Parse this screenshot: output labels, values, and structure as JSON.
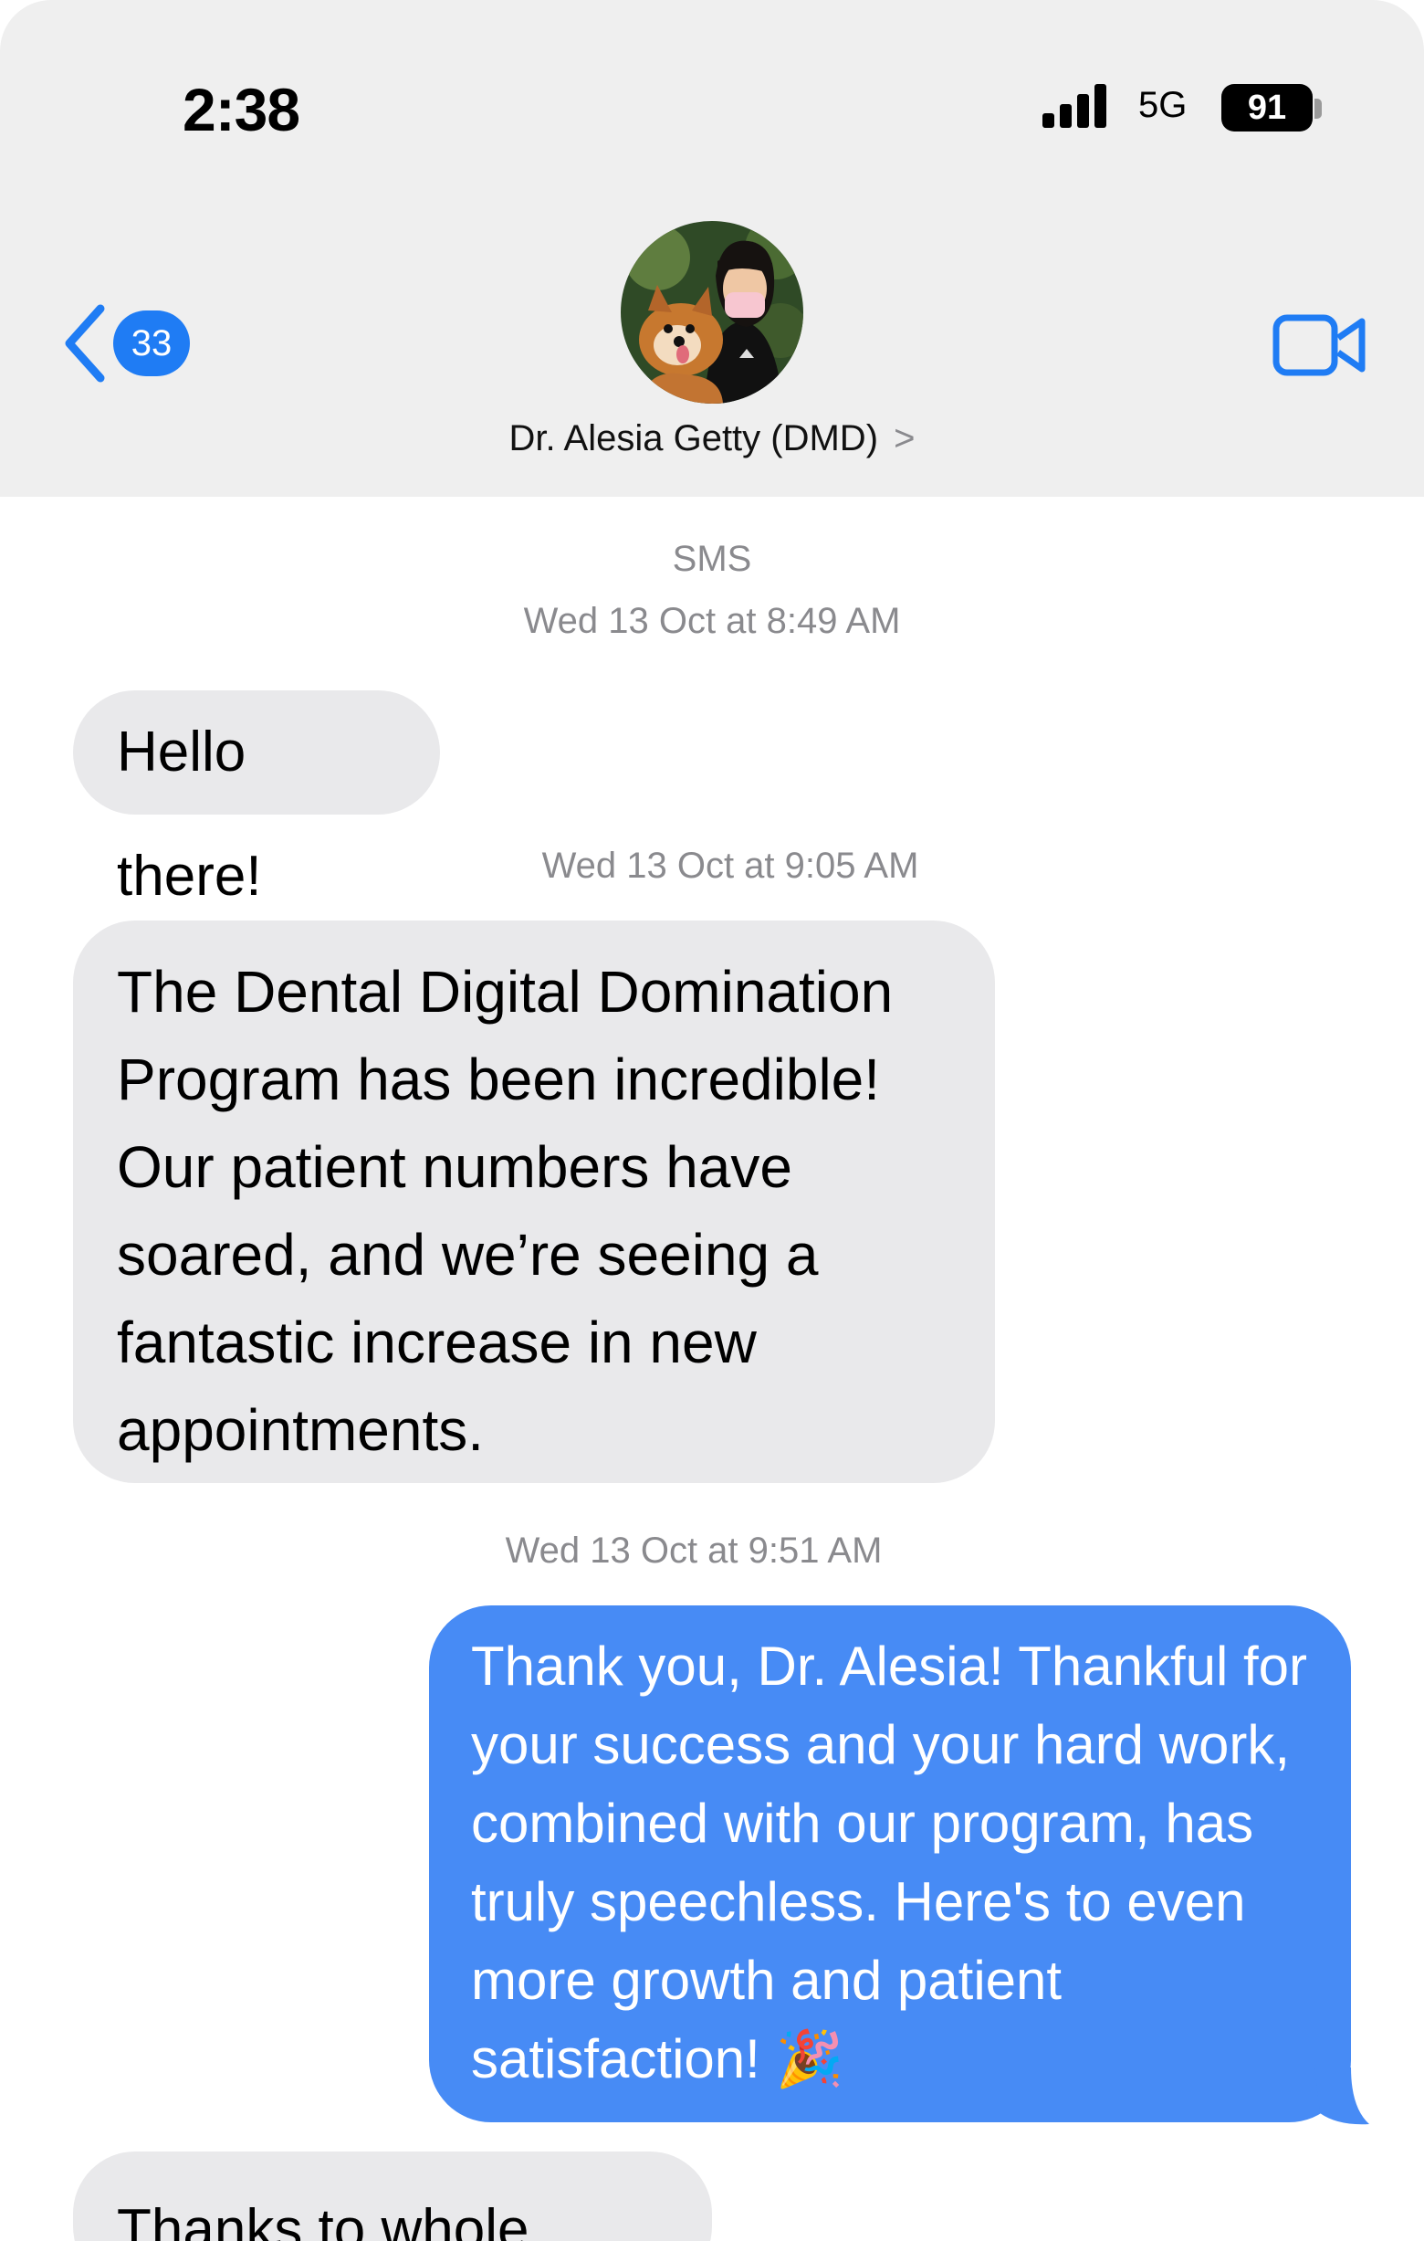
{
  "status_bar": {
    "time": "2:38",
    "network": "5G",
    "battery": "91"
  },
  "header": {
    "back_count": "33",
    "contact_name": "Dr. Alesia Getty (DMD)",
    "contact_chevron": ">"
  },
  "thread": {
    "service": "SMS",
    "messages": [
      {
        "timestamp": "Wed 13 Oct at 8:49 AM",
        "direction": "received",
        "text": "Hello there!"
      },
      {
        "timestamp": "Wed 13 Oct at 9:05 AM",
        "direction": "received",
        "lines": [
          "The Dental Digital Domination",
          "Program has been incredible!",
          "Our patient numbers have",
          "soared, and we’re seeing a",
          "fantastic increase in new",
          "appointments."
        ]
      },
      {
        "timestamp": "Wed 13 Oct at 9:51 AM",
        "direction": "sent",
        "lines": [
          "Thank you, Dr. Alesia! Thankful for",
          "your success and your hard work,",
          "combined with our program, has",
          "truly speechless. Here's to even",
          "more growth and patient",
          "satisfaction! 🎉"
        ]
      },
      {
        "direction": "received",
        "text": "Thanks to whole team!"
      }
    ]
  },
  "icons": [
    "signal-icon",
    "battery-icon",
    "back-chevron-icon",
    "video-camera-icon",
    "avatar-photo"
  ],
  "colors": {
    "accent": "#1f7cf4",
    "sent_bubble": "#478bf5",
    "received_bubble": "#e9e9eb",
    "header_bg": "#efefef"
  }
}
